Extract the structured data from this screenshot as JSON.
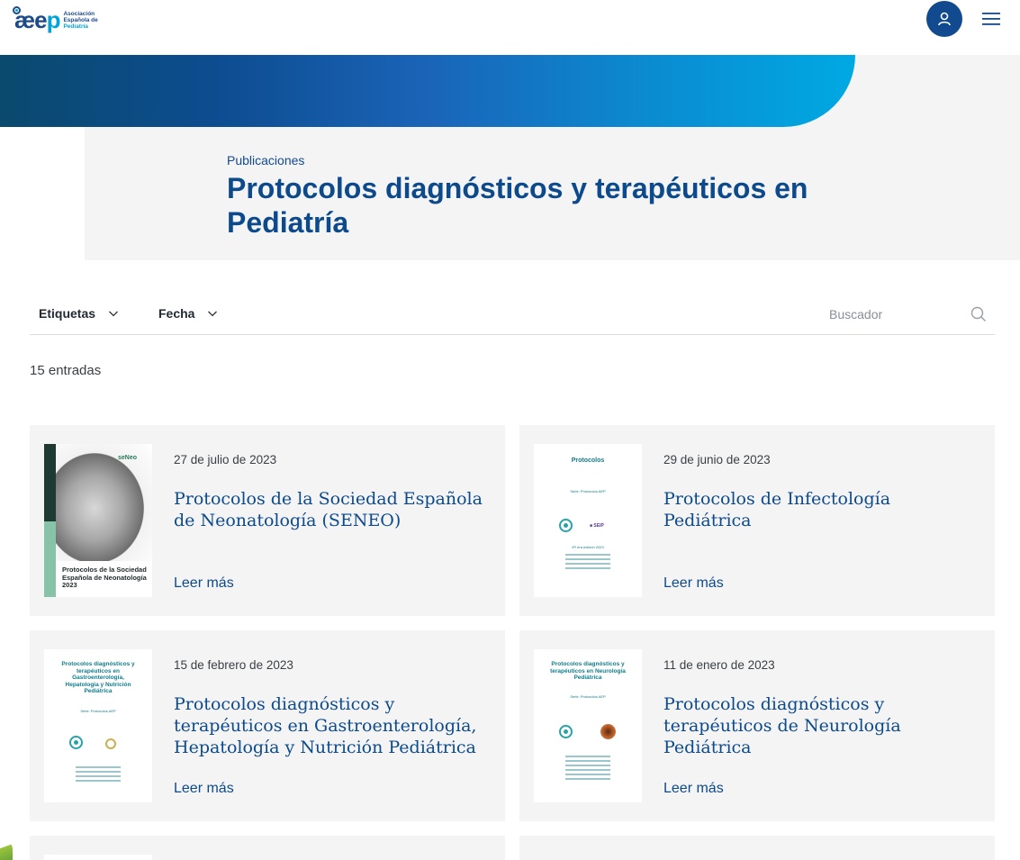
{
  "header": {
    "logo_mark_prefix": "æe",
    "logo_mark_suffix": "p",
    "logo_text_line1": "Asociación",
    "logo_text_line2": "Española de",
    "logo_text_line3": "Pediatría",
    "user_icon": "user-icon",
    "menu_icon": "hamburger-menu-icon"
  },
  "hero": {
    "breadcrumb": "Publicaciones",
    "title": "Protocolos diagnósticos y terapéuticos en Pediatría"
  },
  "filters": {
    "tags_label": "Etiquetas",
    "date_label": "Fecha",
    "search_placeholder": "Buscador",
    "search_value": ""
  },
  "results": {
    "count_label": "15 entradas"
  },
  "cards": [
    {
      "date": "27 de julio de 2023",
      "title": "Protocolos de la Sociedad Española de Neonatología (SENEO)",
      "more": "Leer más",
      "thumb": {
        "logo": "seNeo",
        "caption": "Protocolos de la Sociedad Española de Neonatología 2023"
      }
    },
    {
      "date": "29 de junio de 2023",
      "title": "Protocolos de Infectología Pediátrica",
      "more": "Leer más",
      "thumb": {
        "title": "Protocolos",
        "series": "Serie: Protocolos AEP",
        "year": "4ª/ era edición 2023"
      }
    },
    {
      "date": "15 de febrero de 2023",
      "title": "Protocolos diagnósticos y terapéuticos en Gastroenterología, Hepatología y Nutrición Pediátrica",
      "more": "Leer más",
      "thumb": {
        "title": "Protocolos diagnósticos y terapéuticos en Gastroenterología, Hepatología y Nutrición Pediátrica",
        "series": "Serie: Protocolos AEP"
      }
    },
    {
      "date": "11 de enero de 2023",
      "title": "Protocolos diagnósticos y terapéuticos de Neurología Pediátrica",
      "more": "Leer más",
      "thumb": {
        "title": "Protocolos diagnósticos y terapéuticos en Neurología Pediátrica",
        "series": "Serie: Protocolos AEP"
      }
    }
  ],
  "colors": {
    "brand_dark_blue": "#0d4a8c",
    "brand_light_blue": "#00a9e3",
    "card_background": "#f4f4f4"
  }
}
